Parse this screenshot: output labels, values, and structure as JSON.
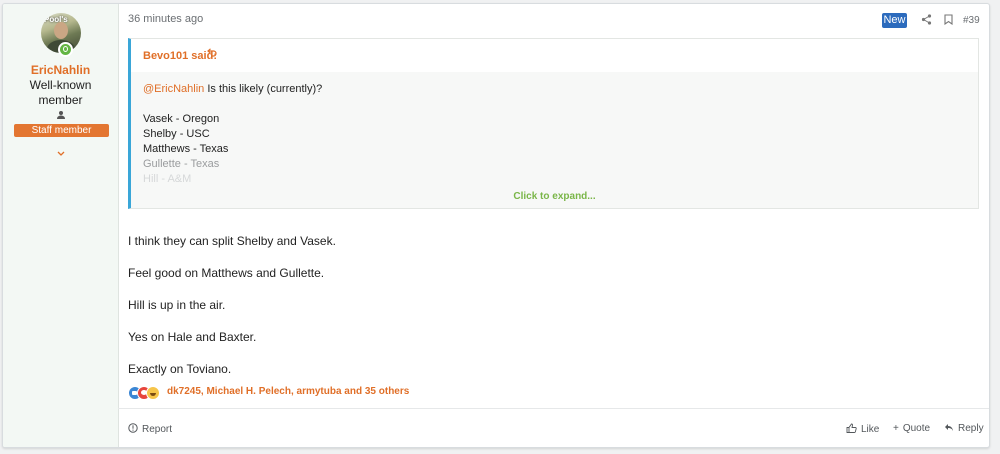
{
  "user": {
    "username": "EricNahlin",
    "avatar_text": "Pool's",
    "title": "Well-known member",
    "staff_badge": "Staff member"
  },
  "post": {
    "time": "36 minutes ago",
    "new_badge": "New",
    "post_number": "#39"
  },
  "quote": {
    "author": "Bevo101 said:",
    "mention": "@EricNahlin",
    "question": "Is this likely (currently)?",
    "lines": [
      "Vasek - Oregon",
      "Shelby - USC",
      "Matthews - Texas",
      "Gullette - Texas",
      "Hill - A&M"
    ],
    "expand_label": "Click to expand..."
  },
  "message": {
    "paragraphs": [
      "I think they can split Shelby and Vasek.",
      "Feel good on Matthews and Gullette.",
      "Hill is up in the air.",
      "Yes on Hale and Baxter.",
      "Exactly on Toviano."
    ]
  },
  "reactions": {
    "text": "dk7245, Michael H. Pelech, armytuba and 35 others",
    "icons": [
      "like-icon",
      "love-icon",
      "haha-icon"
    ]
  },
  "footer": {
    "report": "Report",
    "like": "Like",
    "quote": "Quote",
    "reply": "Reply"
  },
  "colors": {
    "accent": "#e06f28",
    "staff_badge": "#e37631",
    "new_badge": "#2c6bbd",
    "quote_border": "#3aa6d8",
    "expand": "#7ab648",
    "online": "#63b543"
  }
}
